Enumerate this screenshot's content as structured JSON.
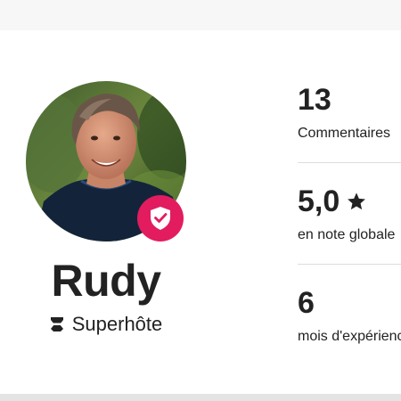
{
  "host": {
    "name": "Rudy",
    "role": "Superhôte",
    "badge_color": "#e31c5f"
  },
  "stats": [
    {
      "value": "13",
      "label": "Commentaires"
    },
    {
      "value": "5,0",
      "label": "en note globale",
      "icon": "star-icon"
    },
    {
      "value": "6",
      "label": "mois d'expérience"
    }
  ],
  "icons": {
    "verified_badge": "shield-check-icon",
    "superhost": "superhost-icon",
    "rating": "star-icon"
  }
}
